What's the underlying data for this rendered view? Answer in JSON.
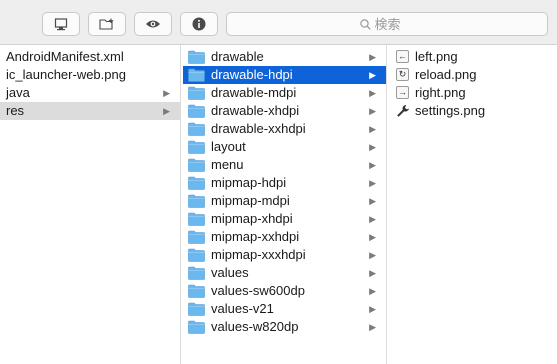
{
  "toolbar": {
    "search_placeholder": "検索",
    "buttons": [
      "computer-icon",
      "new-folder-icon",
      "eye-icon",
      "info-icon"
    ]
  },
  "column1": {
    "items": [
      {
        "label": "AndroidManifest.xml",
        "has_children": false
      },
      {
        "label": "ic_launcher-web.png",
        "has_children": false
      },
      {
        "label": "java",
        "has_children": true
      },
      {
        "label": "res",
        "has_children": true
      }
    ],
    "selected": "res"
  },
  "column2": {
    "items": [
      {
        "label": "drawable"
      },
      {
        "label": "drawable-hdpi"
      },
      {
        "label": "drawable-mdpi"
      },
      {
        "label": "drawable-xhdpi"
      },
      {
        "label": "drawable-xxhdpi"
      },
      {
        "label": "layout"
      },
      {
        "label": "menu"
      },
      {
        "label": "mipmap-hdpi"
      },
      {
        "label": "mipmap-mdpi"
      },
      {
        "label": "mipmap-xhdpi"
      },
      {
        "label": "mipmap-xxhdpi"
      },
      {
        "label": "mipmap-xxxhdpi"
      },
      {
        "label": "values"
      },
      {
        "label": "values-sw600dp"
      },
      {
        "label": "values-v21"
      },
      {
        "label": "values-w820dp"
      }
    ],
    "selected": "drawable-hdpi"
  },
  "column3": {
    "items": [
      {
        "label": "left.png",
        "icon": "left-arrow-icon"
      },
      {
        "label": "reload.png",
        "icon": "reload-icon"
      },
      {
        "label": "right.png",
        "icon": "right-arrow-icon"
      },
      {
        "label": "settings.png",
        "icon": "wrench-icon"
      }
    ]
  },
  "colors": {
    "selection_blue": "#0f63d9",
    "selection_gray": "#dcdcdc",
    "folder_blue": "#6bb8ee",
    "toolbar_bg": "#eeeeee"
  }
}
